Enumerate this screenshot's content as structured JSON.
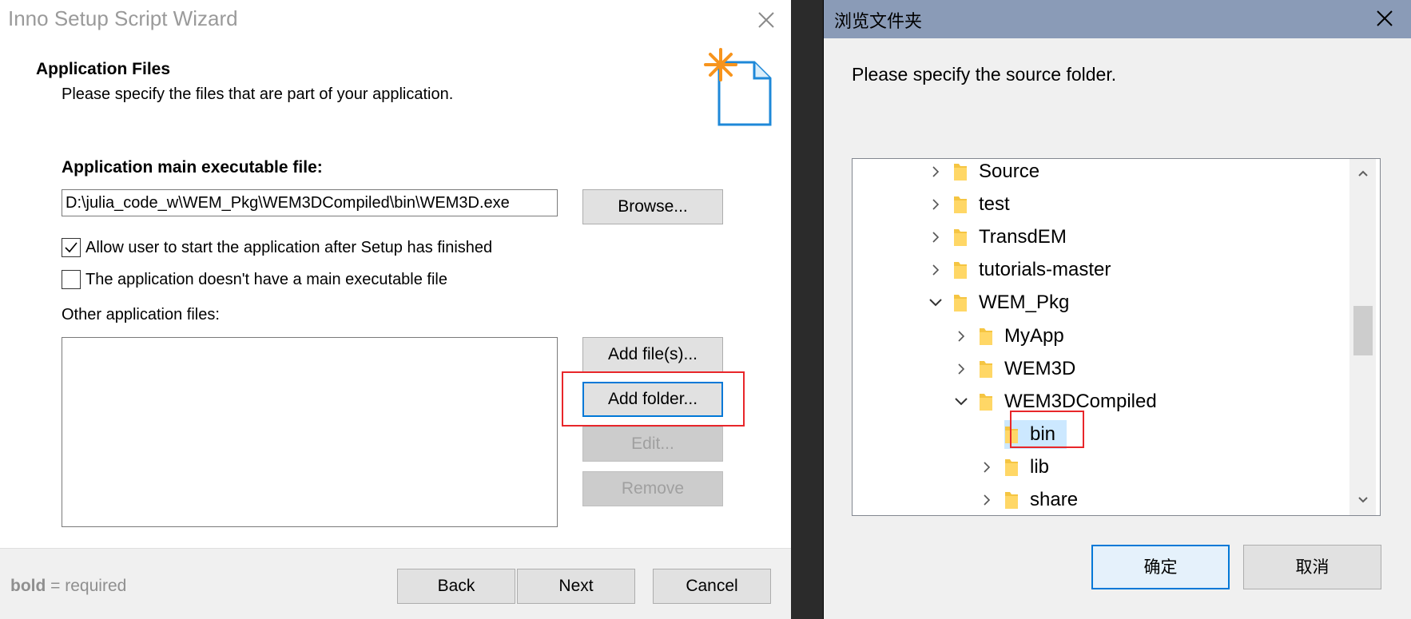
{
  "wizard": {
    "title": "Inno Setup Script Wizard",
    "header_title": "Application Files",
    "header_subtitle": "Please specify the files that are part of your application.",
    "exe_label": "Application main executable file:",
    "exe_value": "D:\\julia_code_w\\WEM_Pkg\\WEM3DCompiled\\bin\\WEM3D.exe",
    "browse_label": "Browse...",
    "check_allow_start": {
      "label": "Allow user to start the application after Setup has finished",
      "checked": true
    },
    "check_no_exe": {
      "label": "The application doesn't have a main executable file",
      "checked": false
    },
    "other_files_label": "Other application files:",
    "buttons": {
      "add_files": "Add file(s)...",
      "add_folder": "Add folder...",
      "edit": "Edit...",
      "remove": "Remove",
      "back": "Back",
      "next": "Next",
      "cancel": "Cancel"
    },
    "legend_bold": "bold",
    "legend_rest": " = required"
  },
  "folder_dialog": {
    "title": "浏览文件夹",
    "prompt": "Please specify the source folder.",
    "tree": [
      {
        "label": "Source",
        "depth": 0,
        "state": "collapsed",
        "selected": false
      },
      {
        "label": "test",
        "depth": 0,
        "state": "collapsed",
        "selected": false
      },
      {
        "label": "TransdEM",
        "depth": 0,
        "state": "collapsed",
        "selected": false
      },
      {
        "label": "tutorials-master",
        "depth": 0,
        "state": "collapsed",
        "selected": false
      },
      {
        "label": "WEM_Pkg",
        "depth": 0,
        "state": "expanded",
        "selected": false
      },
      {
        "label": "MyApp",
        "depth": 1,
        "state": "collapsed",
        "selected": false
      },
      {
        "label": "WEM3D",
        "depth": 1,
        "state": "collapsed",
        "selected": false
      },
      {
        "label": "WEM3DCompiled",
        "depth": 1,
        "state": "expanded",
        "selected": false
      },
      {
        "label": "bin",
        "depth": 2,
        "state": "none",
        "selected": true
      },
      {
        "label": "lib",
        "depth": 2,
        "state": "collapsed",
        "selected": false
      },
      {
        "label": "share",
        "depth": 2,
        "state": "collapsed",
        "selected": false
      }
    ],
    "ok_label": "确定",
    "cancel_label": "取消"
  },
  "colors": {
    "titlebar": "#8a9bb7",
    "highlight_red": "#e8262a",
    "focus_blue": "#0078d7",
    "selection": "#cce8ff",
    "folder_yellow": "#f5c542"
  }
}
